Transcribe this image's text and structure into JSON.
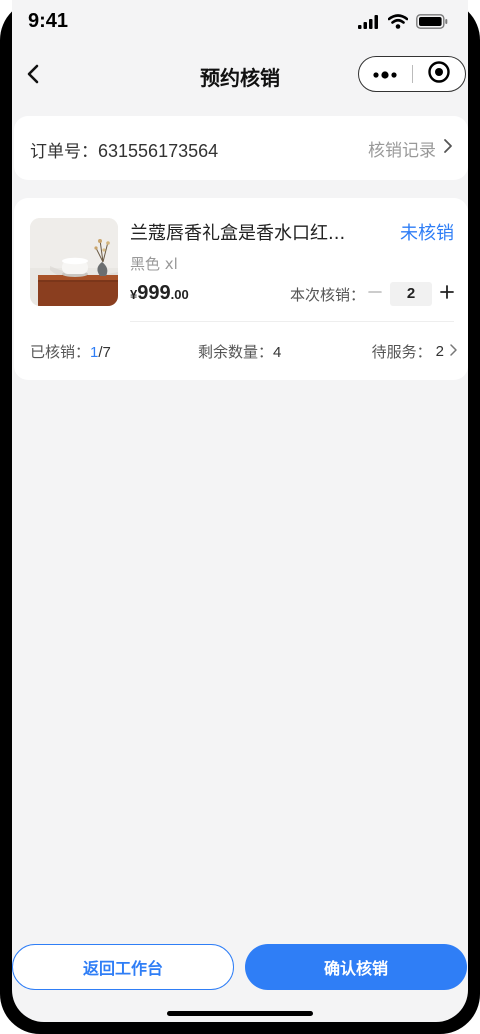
{
  "status_bar": {
    "time": "9:41"
  },
  "nav": {
    "title": "预约核销"
  },
  "order": {
    "label": "订单号：",
    "number": "631556173564",
    "record_link": "核销记录"
  },
  "product": {
    "name": "兰蔻唇香礼盒是香水口红...",
    "status": "未核销",
    "spec": "黑色 xl",
    "price_currency": "¥",
    "price_integer": "999",
    "price_decimal": ".00",
    "stepper_label": "本次核销：",
    "quantity": "2"
  },
  "stats": {
    "verified_label": "已核销：",
    "verified_done": "1",
    "verified_total": "/7",
    "remaining_label": "剩余数量：",
    "remaining_value": "4",
    "pending_label": "待服务：",
    "pending_value": "2"
  },
  "buttons": {
    "back_label": "返回工作台",
    "confirm_label": "确认核销"
  },
  "colors": {
    "accent": "#2f7ef6",
    "background": "#f4f4f5"
  },
  "icons": [
    "back-arrow-icon",
    "more-dots-icon",
    "target-circle-icon",
    "chevron-right-icon",
    "minus-icon",
    "plus-icon",
    "signal-icon",
    "wifi-icon",
    "battery-icon"
  ]
}
